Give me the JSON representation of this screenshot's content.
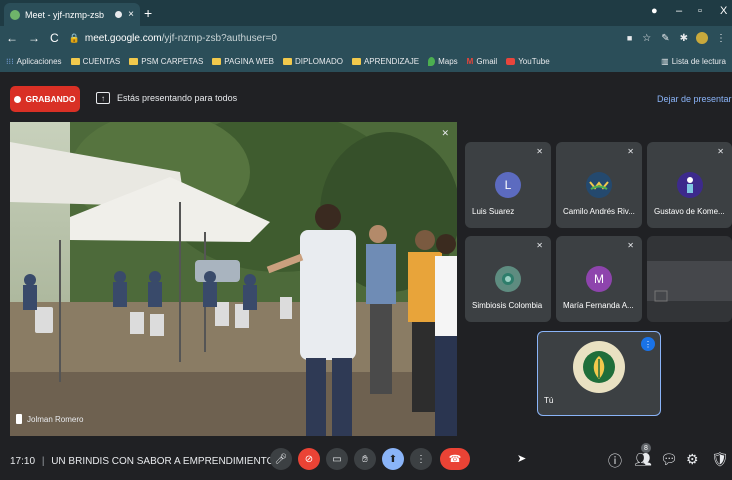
{
  "browser": {
    "tab_title": "Meet - yjf-nzmp-zsb",
    "tab_close": "×",
    "new_tab": "+",
    "win_minimize": "–",
    "win_maximize": "▫",
    "win_close": "X",
    "url_domain": "meet.google.com",
    "url_path": "/yjf-nzmp-zsb?authuser=0",
    "bookmarks": [
      "Aplicaciones",
      "CUENTAS",
      "PSM CARPETAS",
      "PAGINA WEB",
      "DIPLOMADO",
      "APRENDIZAJE",
      "Maps",
      "Gmail",
      "YouTube"
    ],
    "reading_list": "Lista de lectura"
  },
  "meet": {
    "recording_label": "GRABANDO",
    "presenting_text": "Estás presentando para todos",
    "stop_presenting": "Dejar de presentar",
    "main_speaker_name": "Jolman Romero",
    "participants": [
      {
        "name": "Luis Suarez",
        "initial": "L",
        "color": "#5c6bc0"
      },
      {
        "name": "Camilo Andrés Riv...",
        "initial": "",
        "color": "#24496e"
      },
      {
        "name": "Gustavo de Kome...",
        "initial": "",
        "color": "#3d2a8c"
      },
      {
        "name": "Simbiosis Colombia",
        "initial": "",
        "color": "#5e8c80"
      },
      {
        "name": "María Fernanda A...",
        "initial": "M",
        "color": "#8e44ad"
      }
    ],
    "self_label": "Tú",
    "meeting_time": "17:10",
    "meeting_title": "UN BRINDIS CON SABOR A EMPRENDIMIENTO",
    "participants_count": "8"
  }
}
